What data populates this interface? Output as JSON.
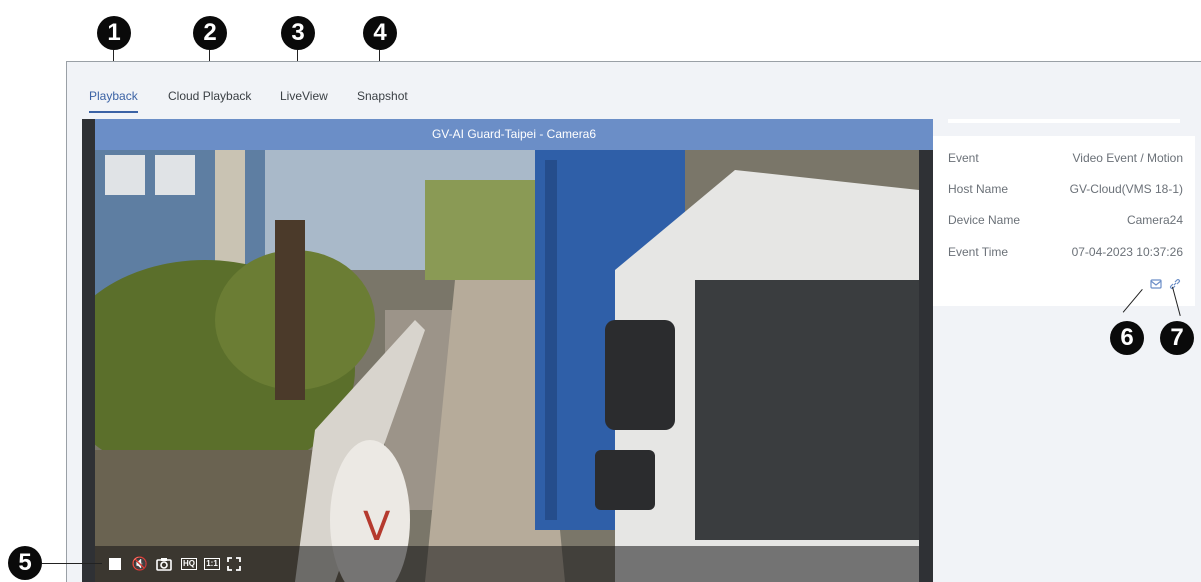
{
  "callouts": [
    "1",
    "2",
    "3",
    "4",
    "5",
    "6",
    "7"
  ],
  "tabs": [
    {
      "label": "Playback",
      "active": true
    },
    {
      "label": "Cloud Playback",
      "active": false
    },
    {
      "label": "LiveView",
      "active": false
    },
    {
      "label": "Snapshot",
      "active": false
    }
  ],
  "player": {
    "title": "GV-AI Guard-Taipei - Camera6",
    "toolbar": {
      "stop_icon": "stop-icon",
      "mute_icon": "mute-icon",
      "snapshot_icon": "camera-icon",
      "hq_label": "HQ",
      "ratio_label": "1:1",
      "fullscreen_icon": "fullscreen-icon"
    }
  },
  "event_info": {
    "rows": [
      {
        "label": "Event",
        "value": "Video Event / Motion"
      },
      {
        "label": "Host Name",
        "value": "GV-Cloud(VMS 18-1)"
      },
      {
        "label": "Device Name",
        "value": "Camera24"
      },
      {
        "label": "Event Time",
        "value": "07-04-2023 10:37:26"
      }
    ],
    "icons": [
      "mail-icon",
      "link-icon"
    ]
  },
  "colors": {
    "accent": "#3b62a5",
    "title_bar": "#6b8ec7",
    "panel_bg": "#f1f3f7"
  }
}
